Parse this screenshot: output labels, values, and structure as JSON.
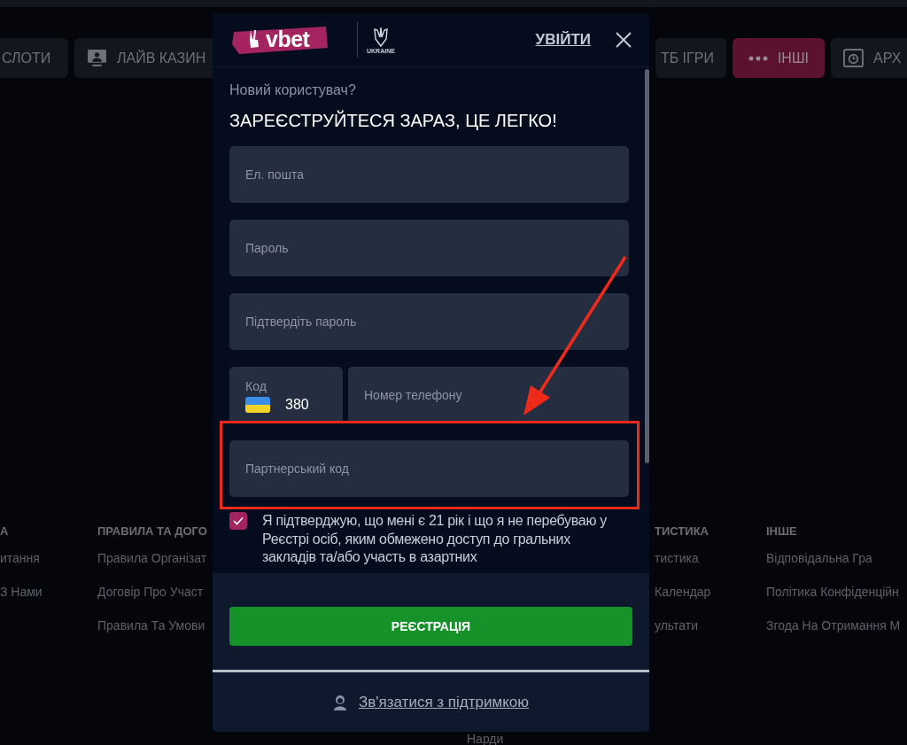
{
  "background": {
    "nav_left": [
      {
        "label": "СЛОТИ",
        "kind": "plain",
        "selected": false
      },
      {
        "label": "ЛАЙВ КАЗИН",
        "kind": "live",
        "selected": false
      }
    ],
    "nav_right": [
      {
        "label": "ТБ ІГРИ",
        "kind": "plain",
        "selected": false
      },
      {
        "label": "ІНШІ",
        "kind": "more",
        "selected": true
      },
      {
        "label": "АРХ",
        "kind": "archive",
        "selected": false
      }
    ],
    "footer_columns": [
      {
        "heading": "А",
        "items": [
          "итання",
          "З Нами"
        ]
      },
      {
        "heading": "ПРАВИЛА ТА ДОГО",
        "items": [
          "Правила Організат",
          "Договір Про Участ",
          "Правила Та Умови"
        ]
      },
      {
        "heading": "ТИСТИКА",
        "items": [
          "тистика",
          "Календар",
          "ультати"
        ]
      },
      {
        "heading": "ІНШЕ",
        "items": [
          "Відповідальна Гра",
          "Політика Конфіденційн",
          "Згода На Отримання М"
        ]
      }
    ],
    "below_modal": "Нарди"
  },
  "modal": {
    "logo": "vbet",
    "emblem_caption": "UKRAINE",
    "login_link": "УВІЙТИ",
    "subtitle": "Новий користувач?",
    "title": "ЗАРЕЄСТРУЙТЕСЯ ЗАРАЗ, ЦЕ ЛЕГКО!",
    "fields": [
      {
        "kind": "text",
        "placeholder": "Ел. пошта",
        "highlighted": false
      },
      {
        "kind": "text",
        "placeholder": "Пароль",
        "highlighted": false
      },
      {
        "kind": "text",
        "placeholder": "Підтвердіть пароль",
        "highlighted": false
      },
      {
        "kind": "phone",
        "code_label": "Код",
        "code_value": "380",
        "placeholder": "Номер телефону",
        "highlighted": false
      },
      {
        "kind": "text",
        "placeholder": "Партнерський код",
        "highlighted": true
      }
    ],
    "consent": {
      "checked": true,
      "text": "Я підтверджую, що мені є 21 рік і що я не перебуваю у Реєстрі осіб, яким обмежено доступ до гральних закладів та/або участь в азартних"
    },
    "submit": "РЕЄСТРАЦІЯ",
    "support_link": "Зв'язатися з підтримкою"
  }
}
